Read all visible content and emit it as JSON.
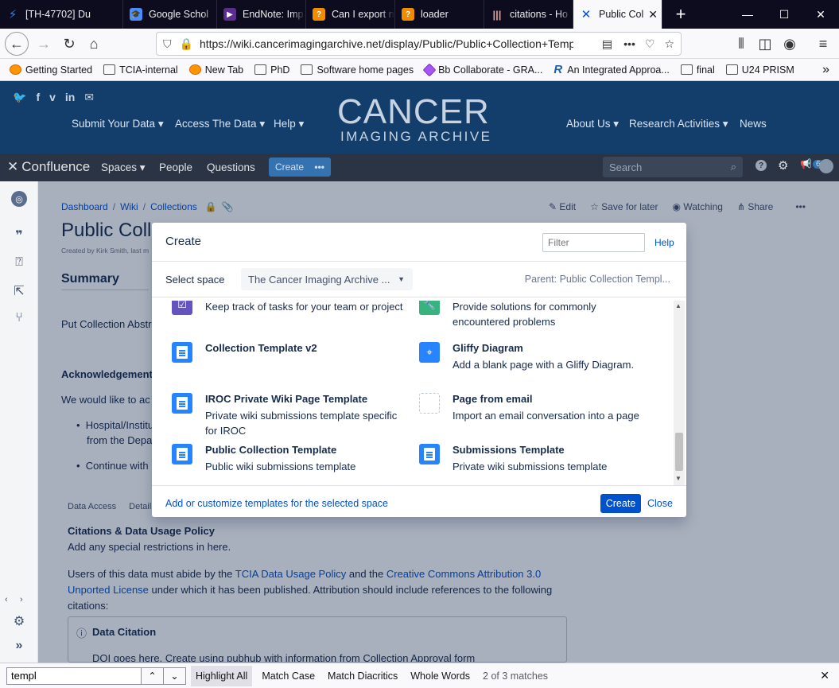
{
  "tabs": [
    {
      "title": "[TH-47702] Du",
      "icon_color": "#2684ff",
      "icon": "bolt-icon"
    },
    {
      "title": "Google Schol",
      "icon_color": "#4a8df6",
      "icon": "scholar-icon"
    },
    {
      "title": "EndNote: Imp",
      "icon_color": "#5b2d8e",
      "icon": "endnote-icon"
    },
    {
      "title": "Can I export n",
      "icon_color": "#f08c00",
      "icon": "question-icon"
    },
    {
      "title": "loader",
      "icon_color": "#f08c00",
      "icon": "question-icon"
    },
    {
      "title": "citations - Ho",
      "icon_color": "#c0392b",
      "icon": "library-icon"
    },
    {
      "title": "Public Col",
      "icon_color": "#0052cc",
      "icon": "confluence-icon",
      "active": true
    }
  ],
  "url": "https://wiki.cancerimagingarchive.net/display/Public/Public+Collection+Templ",
  "bookmarks": [
    "Getting Started",
    "TCIA-internal",
    "New Tab",
    "PhD",
    "Software home pages",
    "Bb Collaborate - GRA...",
    "An Integrated Approa...",
    "final",
    "U24 PRISM"
  ],
  "tcia": {
    "nav_left": [
      "Submit Your Data",
      "Access The Data",
      "Help"
    ],
    "nav_right": [
      "About Us",
      "Research Activities",
      "News"
    ],
    "logo_main": "CANCER",
    "logo_sub": "IMAGING ARCHIVE"
  },
  "confluence": {
    "brand": "Confluence",
    "nav": [
      "Spaces",
      "People",
      "Questions"
    ],
    "create": "Create",
    "search_placeholder": "Search",
    "notif_count": "6"
  },
  "page": {
    "breadcrumb": [
      "Dashboard",
      "Wiki",
      "Collections"
    ],
    "actions": [
      "Edit",
      "Save for later",
      "Watching",
      "Share"
    ],
    "title": "Public Coll",
    "byline": "Created by Kirk Smith, last m",
    "summary": "Summary",
    "abstract": "Put Collection Abstr",
    "ack_heading": "Acknowledgement",
    "ack_text": "We would like to ac",
    "bullet1a": "Hospital/Institu",
    "bullet1b": "from the Depa",
    "bullet2": "Continue with",
    "tab1": "Data Access",
    "tab2": "Detail",
    "policy_heading": "Citations & Data Usage Policy",
    "policy_sub": "Add any special restrictions in here.",
    "policy_text1": "Users of this data must abide by the",
    "policy_link1": "TCIA Data Usage Policy",
    "policy_text2": "and the",
    "policy_link2a": "Creative Commons Attribution 3.0",
    "policy_link2b": "Unported License",
    "policy_text3": "under which it has been published. Attribution should include references to the following",
    "policy_text4": "citations:",
    "citation_heading": "Data Citation",
    "citation_text": "DOI goes here. Create using pubhub with information from Collection Approval form"
  },
  "dialog": {
    "title": "Create",
    "filter_placeholder": "Filter",
    "help": "Help",
    "select_space_label": "Select space",
    "space_value": "The Cancer Imaging Archive ...",
    "parent": "Parent: Public Collection Templ...",
    "templates": [
      {
        "title": "",
        "desc": "Keep track of tasks for your team or project",
        "icon": "task-icon",
        "color": "#6554c0"
      },
      {
        "title": "",
        "desc": "Provide solutions for commonly encountered problems",
        "icon": "wrench-icon",
        "color": "#36b37e"
      },
      {
        "title": "Collection Template v2",
        "desc": "",
        "icon": "document-icon",
        "color": "#2684ff"
      },
      {
        "title": "Gliffy Diagram",
        "desc": "Add a blank page with a Gliffy Diagram.",
        "icon": "gliffy-icon",
        "color": "#2684ff"
      },
      {
        "title": "IROC Private Wiki Page Template",
        "desc": "Private wiki submissions template specific for IROC",
        "icon": "document-icon",
        "color": "#2684ff"
      },
      {
        "title": "Page from email",
        "desc": "Import an email conversation into a page",
        "icon": "email-page-icon",
        "color": "#ffffff"
      },
      {
        "title": "Public Collection Template",
        "desc": "Public wiki submissions template",
        "icon": "document-icon",
        "color": "#2684ff"
      },
      {
        "title": "Submissions Template",
        "desc": "Private wiki submissions template",
        "icon": "document-icon",
        "color": "#2684ff"
      }
    ],
    "footer_link": "Add or customize templates for the selected space",
    "create_btn": "Create",
    "close_btn": "Close"
  },
  "find": {
    "value": "templ",
    "options": [
      "Highlight All",
      "Match Case",
      "Match Diacritics",
      "Whole Words"
    ],
    "matches": "2 of 3 matches"
  }
}
